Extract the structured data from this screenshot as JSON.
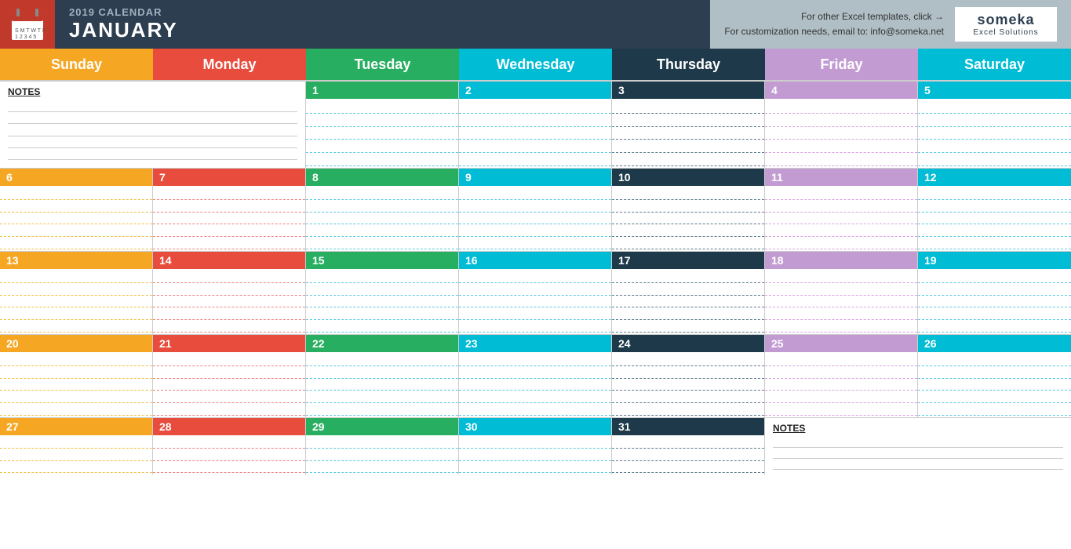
{
  "header": {
    "year": "2019 CALENDAR",
    "month": "JANUARY",
    "link1": "For other Excel templates, click →",
    "link2": "For customization needs, email to: info@someka.net",
    "logo_top": "someka",
    "logo_bottom": "Excel Solutions"
  },
  "days": {
    "sunday": "Sunday",
    "monday": "Monday",
    "tuesday": "Tuesday",
    "wednesday": "Wednesday",
    "thursday": "Thursday",
    "friday": "Friday",
    "saturday": "Saturday"
  },
  "notes_label": "NOTES",
  "weeks": [
    {
      "days": [
        1,
        2,
        3,
        4,
        5
      ],
      "start_day": "tuesday"
    },
    {
      "days": [
        6,
        7,
        8,
        9,
        10,
        11,
        12
      ]
    },
    {
      "days": [
        13,
        14,
        15,
        16,
        17,
        18,
        19
      ]
    },
    {
      "days": [
        20,
        21,
        22,
        23,
        24,
        25,
        26
      ]
    },
    {
      "days": [
        27,
        28,
        29,
        30,
        31
      ],
      "end_day": "thursday"
    }
  ]
}
